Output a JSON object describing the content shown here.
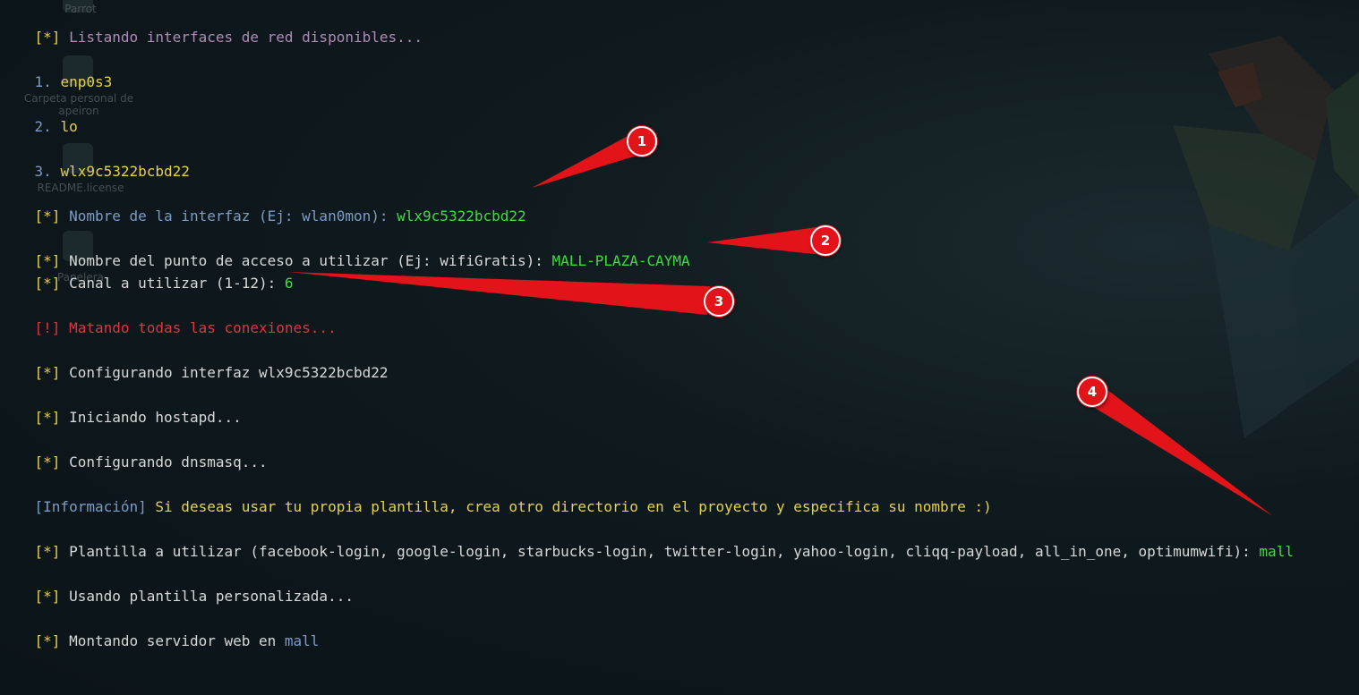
{
  "desktop": {
    "icons": [
      {
        "label": "Parrot"
      },
      {
        "label": "Carpeta personal de apeiron"
      },
      {
        "label": "README.license"
      },
      {
        "label": "Papelera"
      }
    ]
  },
  "terminal": {
    "bracket_star": "[*]",
    "bracket_bang": "[!]",
    "listing": "Listando interfaces de red disponibles...",
    "iface1_num": "1.",
    "iface1": "enp0s3",
    "iface2_num": "2.",
    "iface2": "lo",
    "iface3_num": "3.",
    "iface3": "wlx9c5322bcbd22",
    "iface_prompt": "Nombre de la interfaz (Ej: wlan0mon):",
    "iface_value": "wlx9c5322bcbd22",
    "ap_prompt": "Nombre del punto de acceso a utilizar (Ej: wifiGratis):",
    "ap_value": "MALL-PLAZA-CAYMA",
    "channel_prompt": "Canal a utilizar (1-12):",
    "channel_value": "6",
    "killing": "Matando todas las conexiones...",
    "configuring_iface": "Configurando interfaz wlx9c5322bcbd22",
    "hostapd": "Iniciando hostapd...",
    "dnsmasq": "Configurando dnsmasq...",
    "info_tag": "[Información]",
    "info_text": "Si deseas usar tu propia plantilla, crea otro directorio en el proyecto y especifica su nombre :)",
    "template_prompt": "Plantilla a utilizar (facebook-login, google-login, starbucks-login, twitter-login, yahoo-login, cliqq-payload, all_in_one, optimumwifi):",
    "template_value": "mall",
    "using_template": "Usando plantilla personalizada...",
    "mounting": "Montando servidor web en",
    "mounting_value": "mall"
  },
  "annotations": {
    "markers": [
      "1",
      "2",
      "3",
      "4"
    ],
    "color": "#e3131a"
  },
  "colors": {
    "yellow": "#e8d14a",
    "green": "#3fdc3f",
    "red": "#e0343c",
    "blue": "#7b9cc8",
    "purple": "#b08ab8"
  }
}
